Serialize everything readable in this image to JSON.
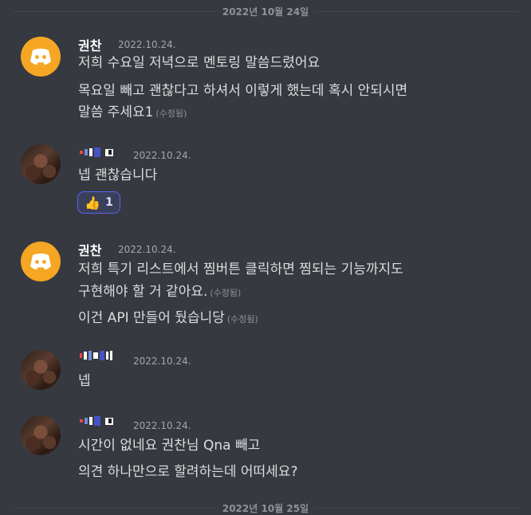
{
  "dividers": {
    "top": "2022년 10월 24일",
    "bottom": "2022년 10월 25일"
  },
  "messages": [
    {
      "author": "권찬",
      "timestamp": "2022.10.24.",
      "lines": [
        "저희 수요일 저녁으로 멘토링 말씀드렸어요",
        "목요일 빼고 괜찮다고 하셔서 이렇게 했는데 혹시 안되시면",
        "말씀 주세요1"
      ],
      "edited": "(수정됨)"
    },
    {
      "timestamp": "2022.10.24.",
      "lines": [
        "넵 괜찮습니다"
      ],
      "reaction": {
        "emoji": "👍",
        "count": "1"
      }
    },
    {
      "author": "권찬",
      "timestamp": "2022.10.24.",
      "lines": [
        "저희 특기 리스트에서 찜버튼 클릭하면 찜되는 기능까지도",
        "구현해야 할 거 같아요.",
        "이건 API 만들어 뒀습니당"
      ],
      "edited": "(수정됨)"
    },
    {
      "timestamp": "2022.10.24.",
      "lines": [
        "넵"
      ]
    },
    {
      "timestamp": "2022.10.24.",
      "lines": [
        "시간이 없네요 권찬님  Qna 빼고",
        "의견 하나만으로 할려하는데 어떠세요?"
      ]
    }
  ],
  "colors": {
    "discord_avatar": "#f5a623",
    "reaction_border": "#5865f2",
    "background": "#36393f"
  },
  "icons": {
    "discord_avatar": "discord-logo-icon",
    "reaction": "thumbs-up-icon"
  }
}
